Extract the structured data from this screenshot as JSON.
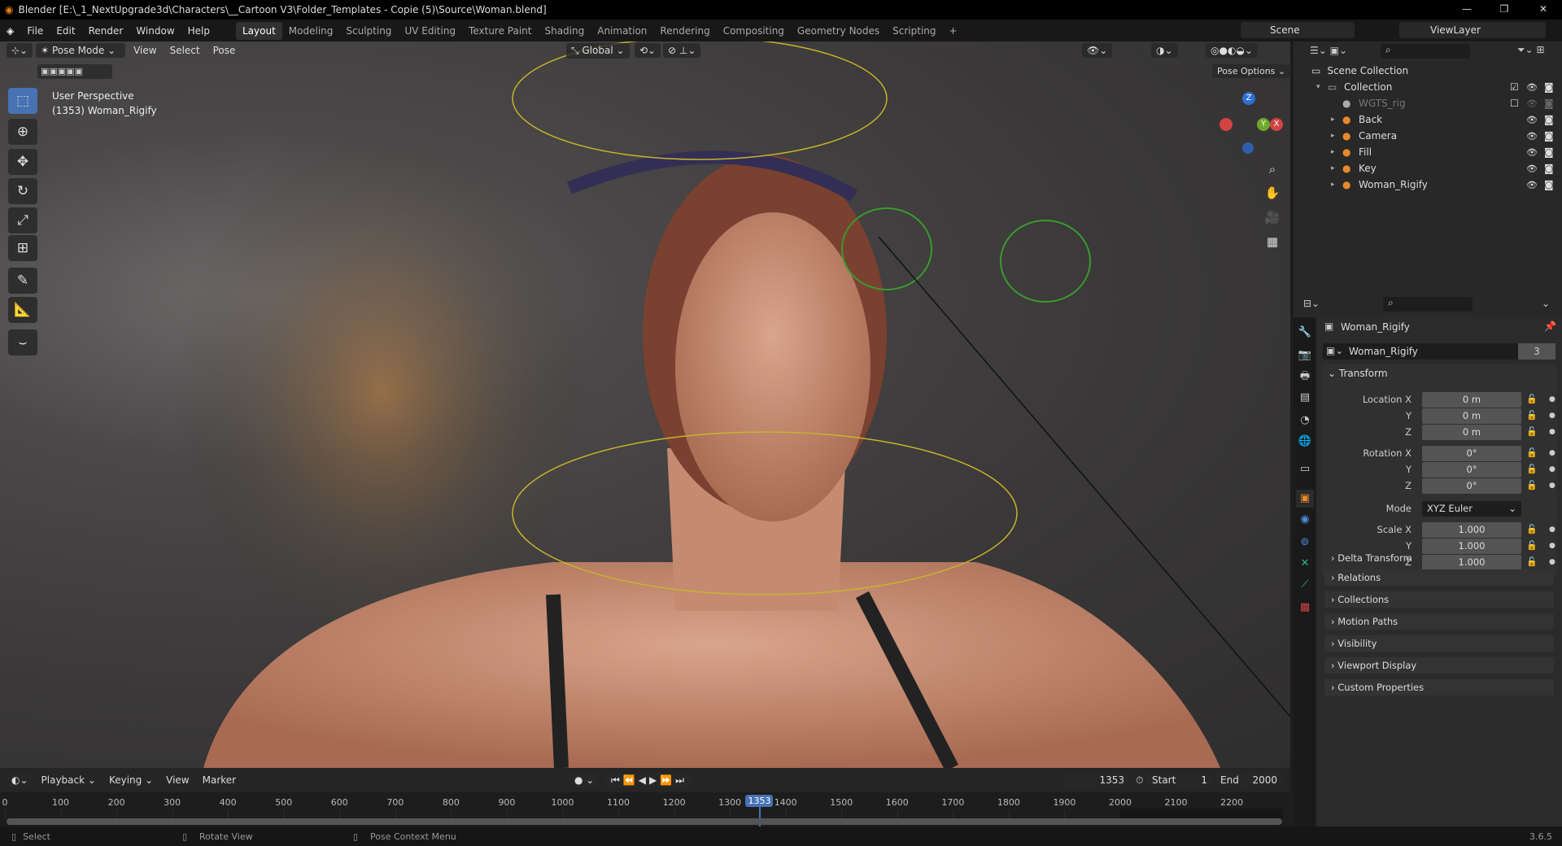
{
  "window": {
    "title": "Blender [E:\\_1_NextUpgrade3d\\Characters\\__Cartoon V3\\Folder_Templates - Copie (5)\\Source\\Woman.blend]",
    "minimize": "—",
    "maximize": "❐",
    "close": "✕"
  },
  "menu": [
    "File",
    "Edit",
    "Render",
    "Window",
    "Help"
  ],
  "workspaces": [
    "Layout",
    "Modeling",
    "Sculpting",
    "UV Editing",
    "Texture Paint",
    "Shading",
    "Animation",
    "Rendering",
    "Compositing",
    "Geometry Nodes",
    "Scripting",
    "+"
  ],
  "scene": {
    "label": "Scene",
    "viewlayer": "ViewLayer"
  },
  "viewport": {
    "mode": "Pose Mode",
    "menus": [
      "View",
      "Select",
      "Pose"
    ],
    "orientation": "Global",
    "pose_options": "Pose Options",
    "overlay_line1": "User Perspective",
    "overlay_line2": "(1353) Woman_Rigify",
    "gizmo": {
      "x": "X",
      "y": "Y",
      "z": "Z"
    }
  },
  "outliner": {
    "root": "Scene Collection",
    "items": [
      {
        "name": "Collection",
        "indent": 1
      },
      {
        "name": "WGTS_rig",
        "indent": 2,
        "disabled": true
      },
      {
        "name": "Back",
        "indent": 2
      },
      {
        "name": "Camera",
        "indent": 2
      },
      {
        "name": "Fill",
        "indent": 2
      },
      {
        "name": "Key",
        "indent": 2
      },
      {
        "name": "Woman_Rigify",
        "indent": 2
      }
    ]
  },
  "properties": {
    "object_name": "Woman_Rigify",
    "data_name": "Woman_Rigify",
    "users": "3",
    "transform_title": "Transform",
    "rows": [
      {
        "label": "Location X",
        "value": "0 m"
      },
      {
        "label": "Y",
        "value": "0 m"
      },
      {
        "label": "Z",
        "value": "0 m"
      },
      {
        "label": "Rotation X",
        "value": "0°"
      },
      {
        "label": "Y",
        "value": "0°"
      },
      {
        "label": "Z",
        "value": "0°"
      },
      {
        "label": "Scale X",
        "value": "1.000"
      },
      {
        "label": "Y",
        "value": "1.000"
      },
      {
        "label": "Z",
        "value": "1.000"
      }
    ],
    "mode_label": "Mode",
    "mode_value": "XYZ Euler",
    "delta": "Delta Transform",
    "panels": [
      "Relations",
      "Collections",
      "Motion Paths",
      "Visibility",
      "Viewport Display",
      "Custom Properties"
    ]
  },
  "timeline": {
    "menus": [
      "Playback",
      "Keying",
      "View",
      "Marker"
    ],
    "current_frame": "1353",
    "start_label": "Start",
    "start": "1",
    "end_label": "End",
    "end": "2000",
    "ticks": [
      0,
      100,
      200,
      300,
      400,
      500,
      600,
      700,
      800,
      900,
      1000,
      1100,
      1200,
      1300,
      1400,
      1500,
      1600,
      1700,
      1800,
      1900,
      2000,
      2100,
      2200
    ],
    "frame_value": 1353
  },
  "status": {
    "select": "Select",
    "rotate": "Rotate View",
    "context": "Pose Context Menu",
    "version": "3.6.5"
  }
}
